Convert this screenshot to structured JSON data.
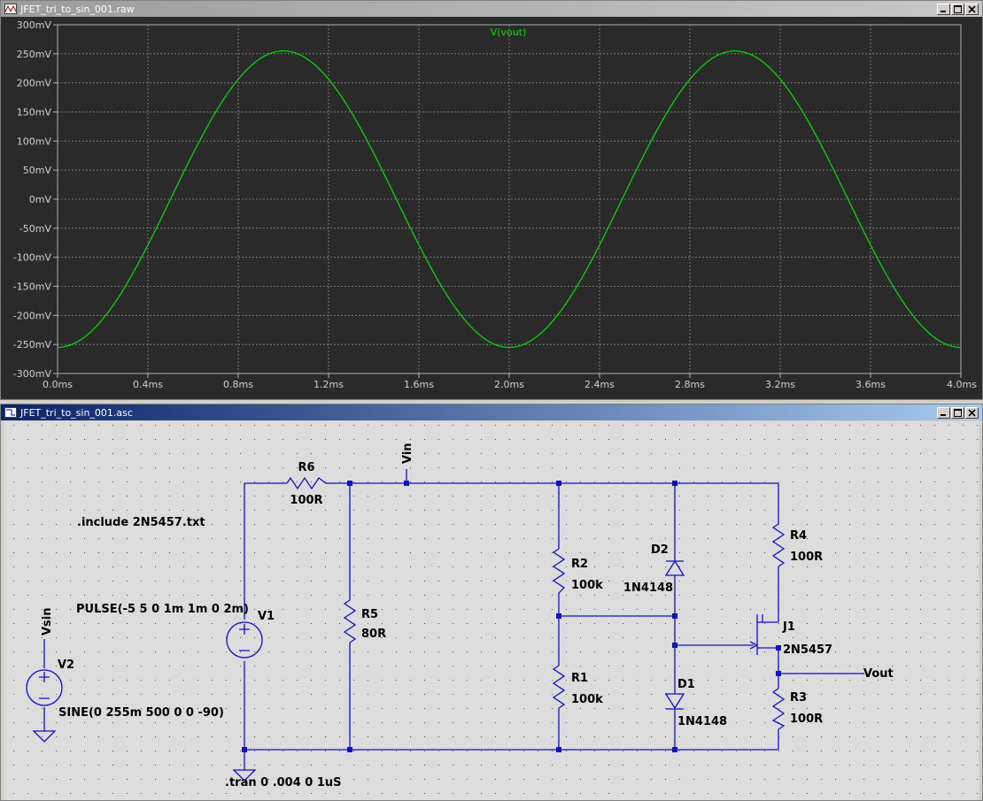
{
  "plot_window": {
    "title": "JFET_tri_to_sin_001.raw",
    "trace_label": "V(vout)",
    "trace_color": "#00e000",
    "background": "#2a2a2a",
    "y_ticks": [
      "300mV",
      "250mV",
      "200mV",
      "150mV",
      "100mV",
      "50mV",
      "0mV",
      "-50mV",
      "-100mV",
      "-150mV",
      "-200mV",
      "-250mV",
      "-300mV"
    ],
    "x_ticks": [
      "0.0ms",
      "0.4ms",
      "0.8ms",
      "1.2ms",
      "1.6ms",
      "2.0ms",
      "2.4ms",
      "2.8ms",
      "3.2ms",
      "3.6ms",
      "4.0ms"
    ]
  },
  "chart_data": {
    "type": "line",
    "title": "V(vout)",
    "xlabel": "",
    "ylabel": "",
    "xlim": [
      0,
      4.0
    ],
    "ylim": [
      -300,
      300
    ],
    "x_unit": "ms",
    "y_unit": "mV",
    "grid": true,
    "series": [
      {
        "name": "V(vout)",
        "amplitude": 255,
        "frequency_hz": 500,
        "phase_deg": -90,
        "x": [
          0,
          0.25,
          0.5,
          0.75,
          1.0,
          1.25,
          1.5,
          1.75,
          2.0,
          2.25,
          2.5,
          2.75,
          3.0,
          3.25,
          3.5,
          3.75,
          4.0
        ],
        "y": [
          -255,
          -180,
          0,
          180,
          255,
          180,
          0,
          -180,
          -255,
          -180,
          0,
          180,
          255,
          180,
          0,
          -180,
          -255
        ]
      }
    ]
  },
  "schematic_window": {
    "title": "JFET_tri_to_sin_001.asc",
    "wire_color": "#1010c8",
    "text_color": "#000000",
    "labels": {
      "r6_name": "R6",
      "r6_value": "100R",
      "vin": "Vin",
      "include": ".include 2N5457.txt",
      "pulse": "PULSE(-5 5 0 1m 1m 0 2m)",
      "v1": "V1",
      "vsin": "Vsin",
      "v2": "V2",
      "sine": "SINE(0 255m 500 0 0 -90)",
      "r5_name": "R5",
      "r5_value": "80R",
      "r2_name": "R2",
      "r2_value": "100k",
      "r1_name": "R1",
      "r1_value": "100k",
      "d2_name": "D2",
      "d2_value": "1N4148",
      "d1_name": "D1",
      "d1_value": "1N4148",
      "r4_name": "R4",
      "r4_value": "100R",
      "j1_name": "J1",
      "j1_value": "2N5457",
      "vout": "Vout",
      "r3_name": "R3",
      "r3_value": "100R",
      "tran": ".tran 0 .004 0 1uS"
    }
  }
}
